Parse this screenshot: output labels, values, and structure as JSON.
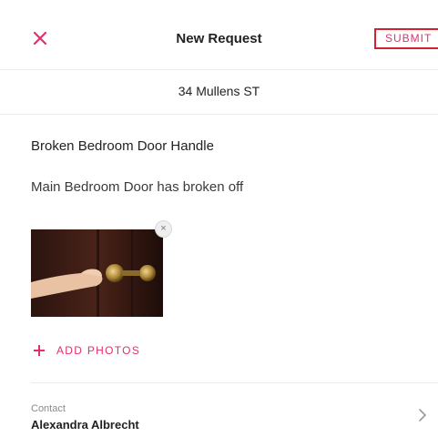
{
  "header": {
    "title": "New Request",
    "submit_label": "SUBMIT",
    "close_icon": "close-icon",
    "accent_color": "#e0306e",
    "highlight_color": "#d4202f"
  },
  "address": "34 Mullens ST",
  "request": {
    "title": "Broken Bedroom Door Handle",
    "description": "Main Bedroom Door has broken off"
  },
  "photos": {
    "count": 1,
    "remove_icon": "close-icon",
    "add_label": "ADD PHOTOS",
    "add_icon": "plus-icon"
  },
  "contact": {
    "caption": "Contact",
    "name": "Alexandra Albrecht",
    "chevron_icon": "chevron-right-icon"
  }
}
